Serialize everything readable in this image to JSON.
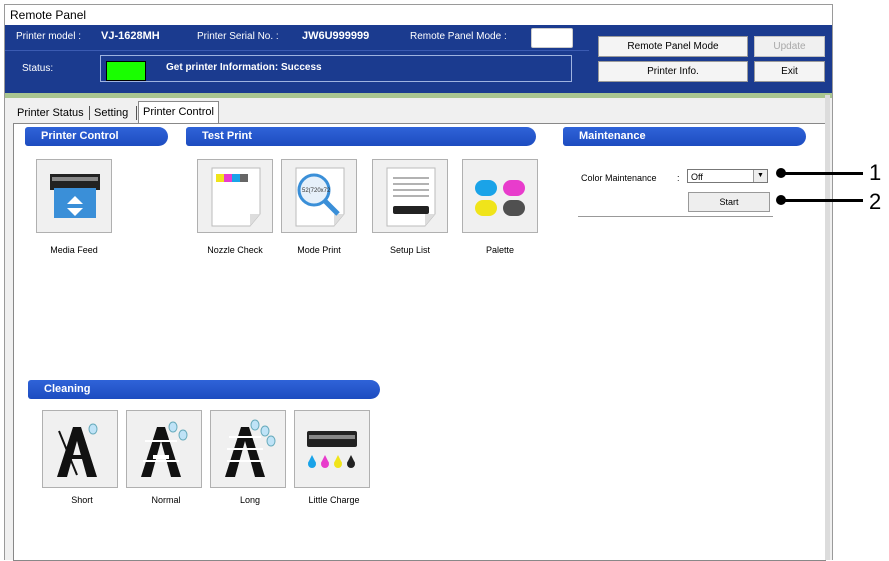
{
  "window": {
    "title": "Remote Panel"
  },
  "header": {
    "printer_model_label": "Printer model :",
    "printer_model": "VJ-1628MH",
    "serial_label": "Printer Serial No. :",
    "serial": "JW6U999999",
    "mode_label": "Remote Panel Mode :",
    "status_label": "Status:",
    "status_text": "Get printer Information: Success",
    "status_color": "#19ff00",
    "buttons": {
      "remote_panel_mode": "Remote Panel Mode",
      "update": "Update",
      "printer_info": "Printer Info.",
      "exit": "Exit"
    }
  },
  "tabs": [
    "Printer Status",
    "Setting",
    "Printer Control"
  ],
  "sections": {
    "printer_control": {
      "title": "Printer Control",
      "items": [
        "Media Feed"
      ]
    },
    "test_print": {
      "title": "Test Print",
      "items": [
        "Nozzle Check",
        "Mode Print",
        "Setup List",
        "Palette"
      ],
      "mode_print_icon_text": "52(720x72"
    },
    "maintenance": {
      "title": "Maintenance",
      "color_label": "Color Maintenance",
      "colon": ":",
      "select_value": "Off",
      "start_label": "Start"
    },
    "cleaning": {
      "title": "Cleaning",
      "items": [
        "Short",
        "Normal",
        "Long",
        "Little Charge"
      ]
    }
  },
  "callouts": [
    "1",
    "2"
  ],
  "colors": {
    "header": "#1b3b8f",
    "section": "#1d4cc0",
    "cyan": "#1aa3e8",
    "magenta": "#e83ccc",
    "yellow": "#f0e41a",
    "black": "#505050"
  }
}
